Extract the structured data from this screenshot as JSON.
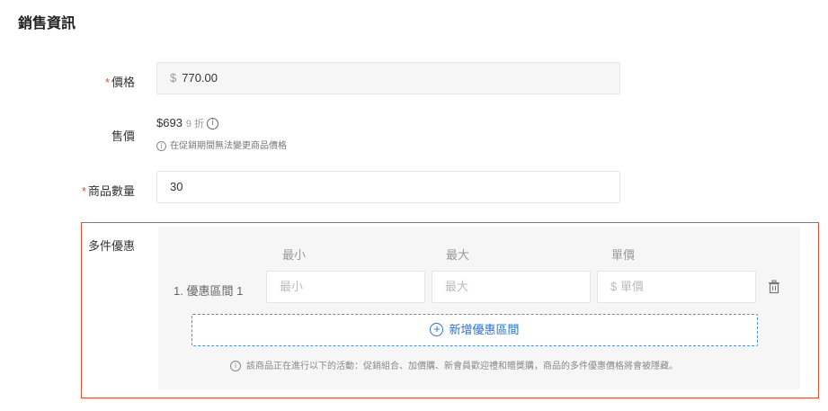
{
  "section": {
    "title": "銷售資訊"
  },
  "price": {
    "required_mark": "*",
    "label": "價格",
    "currency": "$",
    "value": "770.00"
  },
  "sale_price": {
    "label": "售價",
    "amount": "$693",
    "discount": "9 折",
    "info_glyph": "i",
    "note": "在促銷期間無法變更商品價格"
  },
  "quantity": {
    "required_mark": "*",
    "label": "商品數量",
    "value": "30"
  },
  "wholesale": {
    "label": "多件優惠",
    "columns": {
      "min": "最小",
      "max": "最大",
      "unit": "單價"
    },
    "tiers": [
      {
        "label": "1. 優惠區間 1",
        "min_placeholder": "最小",
        "max_placeholder": "最大",
        "unit_placeholder": "$ 單價"
      }
    ],
    "add_label": "新增優惠區間",
    "note": "該商品正在進行以下的活動：促銷組合、加價購、新會員歡迎禮和贈獎購，商品的多件優惠價格將會被隱藏。"
  },
  "colors": {
    "accent": "#ee4d2d",
    "link": "#2673dd"
  }
}
